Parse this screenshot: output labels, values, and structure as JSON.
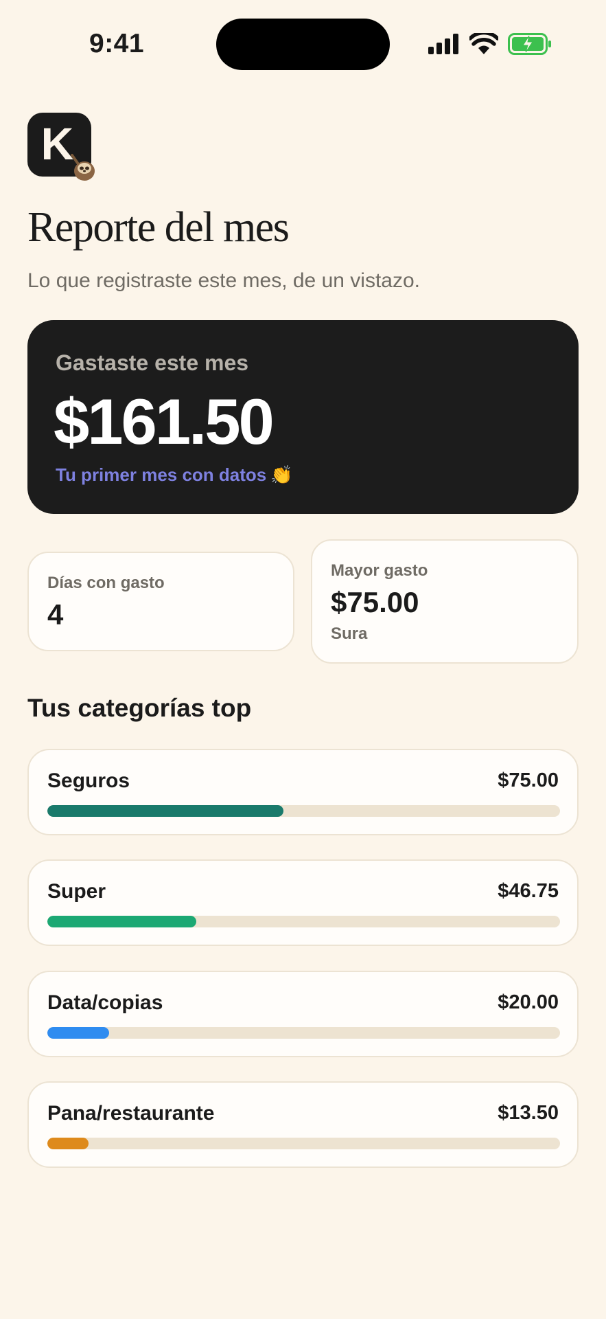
{
  "status_bar": {
    "time": "9:41",
    "icons": [
      "signal-icon",
      "wifi-icon",
      "battery-charging-icon"
    ],
    "battery_color": "#3cc04e"
  },
  "logo": {
    "letter": "K",
    "mascot": "sloth-icon"
  },
  "page": {
    "title": "Reporte del mes",
    "subtitle": "Lo que registraste este mes, de un vistazo."
  },
  "summary": {
    "label": "Gastaste este mes",
    "amount": "$161.50",
    "note": "Tu primer mes con datos",
    "note_emoji": "👏"
  },
  "stats": {
    "days": {
      "label": "Días con gasto",
      "value": "4"
    },
    "max": {
      "label": "Mayor gasto",
      "value": "$75.00",
      "sub": "Sura"
    }
  },
  "categories_title": "Tus categorías top",
  "categories": [
    {
      "name": "Seguros",
      "amount": "$75.00",
      "fraction": 0.46,
      "color": "#1a7a6b"
    },
    {
      "name": "Super",
      "amount": "$46.75",
      "fraction": 0.29,
      "color": "#1ca873"
    },
    {
      "name": "Data/copias",
      "amount": "$20.00",
      "fraction": 0.12,
      "color": "#2f8cf0"
    },
    {
      "name": "Pana/restaurante",
      "amount": "$13.50",
      "fraction": 0.08,
      "color": "#de8a1b"
    }
  ]
}
